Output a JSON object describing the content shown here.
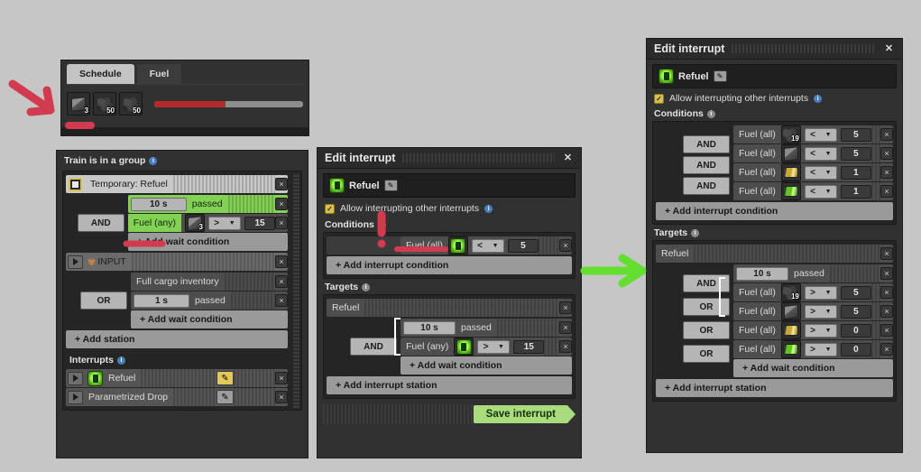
{
  "fuel_panel": {
    "tabs": [
      {
        "label": "Schedule",
        "active": true
      },
      {
        "label": "Fuel",
        "active": false
      }
    ],
    "slots": [
      {
        "icon": "solid-fuel-icon",
        "count": "3"
      },
      {
        "icon": "coal-icon",
        "count": "50"
      },
      {
        "icon": "coal-icon",
        "count": "50"
      }
    ],
    "progress_percent": 48,
    "progress_color": "#b52a2a"
  },
  "schedule_panel": {
    "header": "Train is in a group",
    "station_temporary": "Temporary: Refuel",
    "group1": {
      "operator": "AND",
      "conditions": [
        {
          "type": "time",
          "value": "10 s",
          "label": "passed",
          "highlight": "green"
        },
        {
          "type": "fuel",
          "label": "Fuel (any)",
          "icon": "solid-fuel-icon",
          "icon_count": "3",
          "comparator": ">",
          "value": "15",
          "highlight": "green-label"
        }
      ],
      "add_label": "+ Add wait condition"
    },
    "station_input": "INPUT",
    "group2": {
      "operator": "OR",
      "conditions": [
        {
          "type": "cargo",
          "label": "Full cargo inventory"
        },
        {
          "type": "time",
          "value": "1 s",
          "label": "passed"
        }
      ],
      "add_label": "+ Add wait condition"
    },
    "add_station": "+ Add station",
    "interrupts_label": "Interrupts",
    "interrupts": [
      {
        "label": "Refuel",
        "icon": "fuel-signal-icon",
        "pencil": "gold"
      },
      {
        "label": "Parametrized Drop",
        "icon": "none",
        "pencil": "grey"
      }
    ]
  },
  "center_dialog": {
    "title": "Edit interrupt",
    "name": "Refuel",
    "allow_label": "Allow interrupting other interrupts",
    "allow_checked": true,
    "conditions_label": "Conditions",
    "conditions": [
      {
        "label": "Fuel (all)",
        "icon": "fuel-signal-icon",
        "comparator": "<",
        "value": "5"
      }
    ],
    "add_condition": "+ Add interrupt condition",
    "targets_label": "Targets",
    "target_station": "Refuel",
    "target_operator": "AND",
    "target_conditions": [
      {
        "type": "time",
        "value": "10 s",
        "label": "passed"
      },
      {
        "type": "fuel",
        "label": "Fuel (any)",
        "icon": "fuel-signal-icon",
        "comparator": ">",
        "value": "15"
      }
    ],
    "add_wait": "+ Add wait condition",
    "add_station": "+ Add interrupt station",
    "save_label": "Save interrupt"
  },
  "right_dialog": {
    "title": "Edit interrupt",
    "name": "Refuel",
    "allow_label": "Allow interrupting other interrupts",
    "allow_checked": true,
    "conditions_label": "Conditions",
    "conditions": [
      {
        "label": "Fuel (all)",
        "icon": "coal-icon",
        "icon_count": "19",
        "comparator": "<",
        "value": "5",
        "op": ""
      },
      {
        "label": "Fuel (all)",
        "icon": "solid-fuel-icon",
        "comparator": "<",
        "value": "5",
        "op": "AND"
      },
      {
        "label": "Fuel (all)",
        "icon": "rocket-fuel-icon",
        "comparator": "<",
        "value": "1",
        "op": "AND"
      },
      {
        "label": "Fuel (all)",
        "icon": "nuclear-fuel-icon",
        "comparator": "<",
        "value": "1",
        "op": "AND"
      }
    ],
    "add_condition": "+ Add interrupt condition",
    "targets_label": "Targets",
    "target_station": "Refuel",
    "target_conditions": [
      {
        "type": "time",
        "value": "10 s",
        "label": "passed",
        "op": ""
      },
      {
        "type": "fuel",
        "label": "Fuel (all)",
        "icon": "coal-icon",
        "icon_count": "19",
        "comparator": ">",
        "value": "5",
        "op": "AND"
      },
      {
        "type": "fuel",
        "label": "Fuel (all)",
        "icon": "solid-fuel-icon",
        "comparator": ">",
        "value": "5",
        "op": "OR"
      },
      {
        "type": "fuel",
        "label": "Fuel (all)",
        "icon": "rocket-fuel-icon",
        "comparator": ">",
        "value": "0",
        "op": "OR"
      },
      {
        "type": "fuel",
        "label": "Fuel (all)",
        "icon": "nuclear-fuel-icon",
        "comparator": ">",
        "value": "0",
        "op": "OR"
      }
    ],
    "add_wait": "+ Add wait condition",
    "add_station": "+ Add interrupt station"
  },
  "annotations": {
    "red_arrow": "arrow pointing down-right at fuel slots",
    "green_arrow": "arrow pointing right from center dialog to right dialog",
    "red_color": "#d23b4f",
    "green_color": "#63dd2e"
  }
}
